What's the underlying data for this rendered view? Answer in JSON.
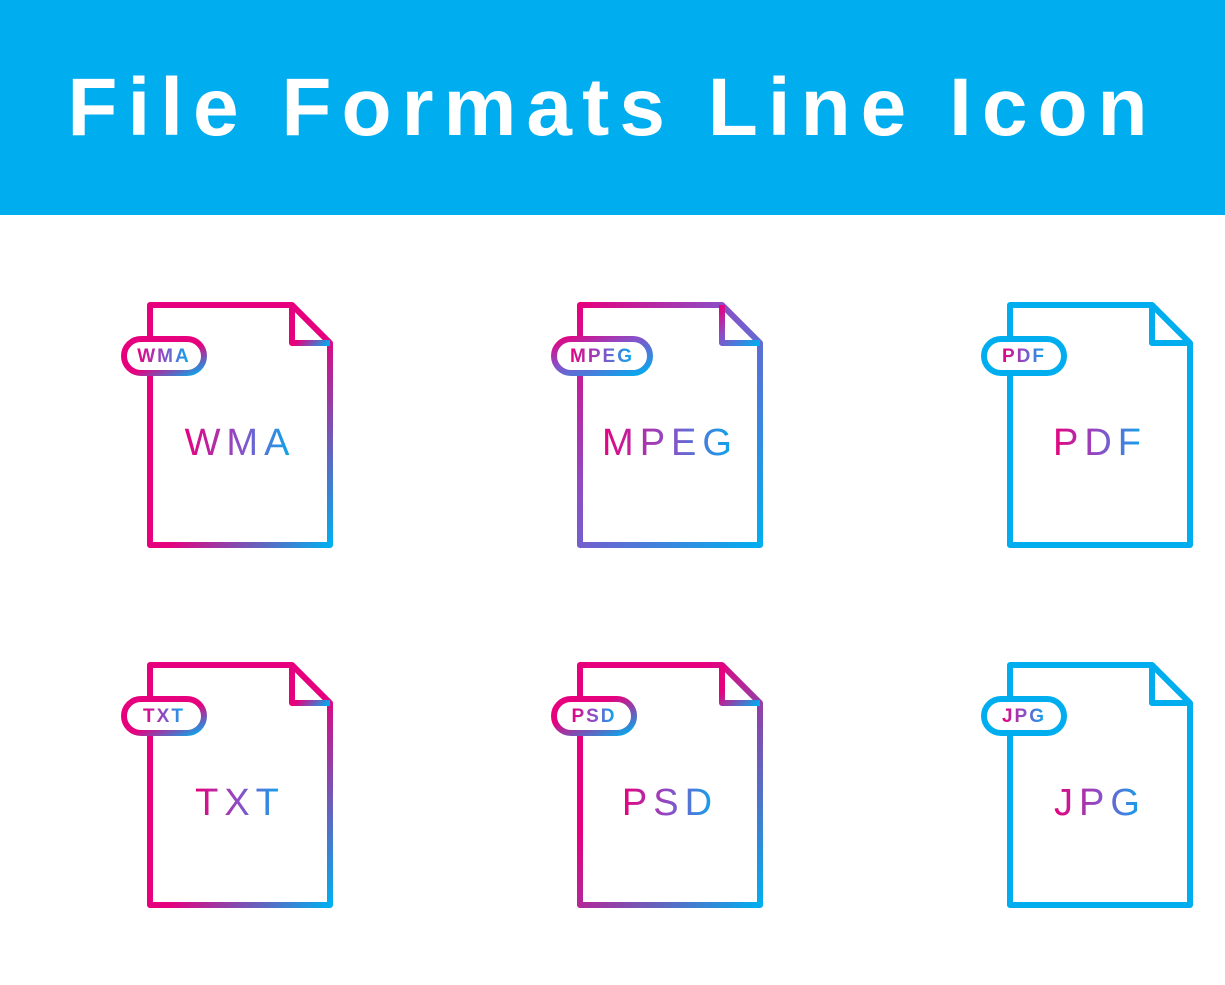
{
  "header": {
    "title": "File Formats Line Icon"
  },
  "colors": {
    "cyan": "#00aeef",
    "magenta": "#e6007e",
    "banner": "#00aeef"
  },
  "icons": [
    {
      "badge": "WMA",
      "body": "WMA",
      "gradient": "heavy-mag"
    },
    {
      "badge": "MPEG",
      "body": "MPEG",
      "gradient": "mix-a"
    },
    {
      "badge": "PDF",
      "body": "PDF",
      "gradient": "heavy-cyan"
    },
    {
      "badge": "TXT",
      "body": "TXT",
      "gradient": "heavy-mag"
    },
    {
      "badge": "PSD",
      "body": "PSD",
      "gradient": "mix-b"
    },
    {
      "badge": "JPG",
      "body": "JPG",
      "gradient": "heavy-cyan"
    }
  ]
}
